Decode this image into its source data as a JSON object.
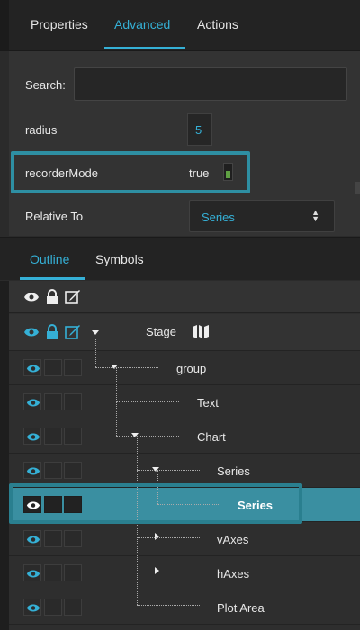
{
  "top_tabs": [
    {
      "label": "Properties",
      "active": false
    },
    {
      "label": "Advanced",
      "active": true
    },
    {
      "label": "Actions",
      "active": false
    }
  ],
  "search": {
    "label": "Search:",
    "value": "",
    "placeholder": ""
  },
  "properties": {
    "radius": {
      "label": "radius",
      "value": "5"
    },
    "recorder_mode": {
      "label": "recorderMode",
      "value": "true"
    },
    "relative_to": {
      "label": "Relative To",
      "value": "Series"
    }
  },
  "panel_tabs": [
    {
      "label": "Outline",
      "active": true
    },
    {
      "label": "Symbols",
      "active": false
    }
  ],
  "outline": {
    "header_icons": [
      "eye-icon",
      "lock-icon",
      "edit-icon"
    ],
    "stage_label": "Stage",
    "nodes": [
      {
        "label": "group",
        "depth": 1,
        "toggle": "expanded"
      },
      {
        "label": "Text",
        "depth": 2,
        "toggle": "none"
      },
      {
        "label": "Chart",
        "depth": 2,
        "toggle": "expanded"
      },
      {
        "label": "Series",
        "depth": 3,
        "toggle": "expanded"
      },
      {
        "label": "Series",
        "depth": 4,
        "toggle": "none",
        "selected": true
      },
      {
        "label": "vAxes",
        "depth": 3,
        "toggle": "collapsed"
      },
      {
        "label": "hAxes",
        "depth": 3,
        "toggle": "collapsed"
      },
      {
        "label": "Plot Area",
        "depth": 3,
        "toggle": "none"
      }
    ]
  },
  "colors": {
    "accent": "#35b0d6",
    "selection": "#3a8fa1",
    "highlight_border": "#2e8fa3",
    "toggle_on": "#5fa043"
  }
}
